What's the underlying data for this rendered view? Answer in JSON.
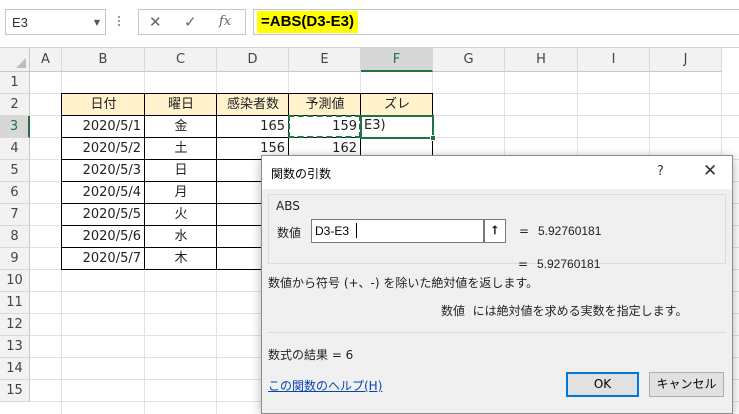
{
  "formula_bar": {
    "name_box": "E3",
    "cancel_icon": "✕",
    "enter_icon": "✓",
    "fx_icon": "fx",
    "formula": "=ABS(D3-E3)"
  },
  "columns": [
    "A",
    "B",
    "C",
    "D",
    "E",
    "F",
    "G",
    "H",
    "I",
    "J"
  ],
  "rows": [
    "1",
    "2",
    "3",
    "4",
    "5",
    "6",
    "7",
    "8",
    "9",
    "10",
    "11",
    "12",
    "13",
    "14",
    "15"
  ],
  "table": {
    "headers": [
      "日付",
      "曜日",
      "感染者数",
      "予測値",
      "ズレ"
    ],
    "rows": [
      {
        "date": "2020/5/1",
        "day": "金",
        "cases": "165",
        "forecast": "159",
        "diff": "E3)"
      },
      {
        "date": "2020/5/2",
        "day": "土",
        "cases": "156",
        "forecast": "162",
        "diff": ""
      },
      {
        "date": "2020/5/3",
        "day": "日",
        "cases": "",
        "forecast": "",
        "diff": ""
      },
      {
        "date": "2020/5/4",
        "day": "月",
        "cases": "",
        "forecast": "",
        "diff": ""
      },
      {
        "date": "2020/5/5",
        "day": "火",
        "cases": "",
        "forecast": "",
        "diff": ""
      },
      {
        "date": "2020/5/6",
        "day": "水",
        "cases": "",
        "forecast": "",
        "diff": ""
      },
      {
        "date": "2020/5/7",
        "day": "木",
        "cases": "",
        "forecast": "",
        "diff": ""
      }
    ]
  },
  "dialog": {
    "title": "関数の引数",
    "help_button": "?",
    "close_button": "✕",
    "function_name": "ABS",
    "arg_label": "数値",
    "arg_value": "D3-E3",
    "collapse_icon": "⭡",
    "eq1": "=",
    "arg_result": "5.92760181",
    "eq2": "=",
    "func_result": "5.92760181",
    "description": "数値から符号 (+、-) を除いた絶対値を返します。",
    "arg_desc_name": "数値",
    "arg_desc_text": "には絶対値を求める実数を指定します。",
    "result_text": "数式の結果 =   6",
    "help_link": "この関数のヘルプ(H)",
    "ok": "OK",
    "cancel": "キャンセル"
  }
}
